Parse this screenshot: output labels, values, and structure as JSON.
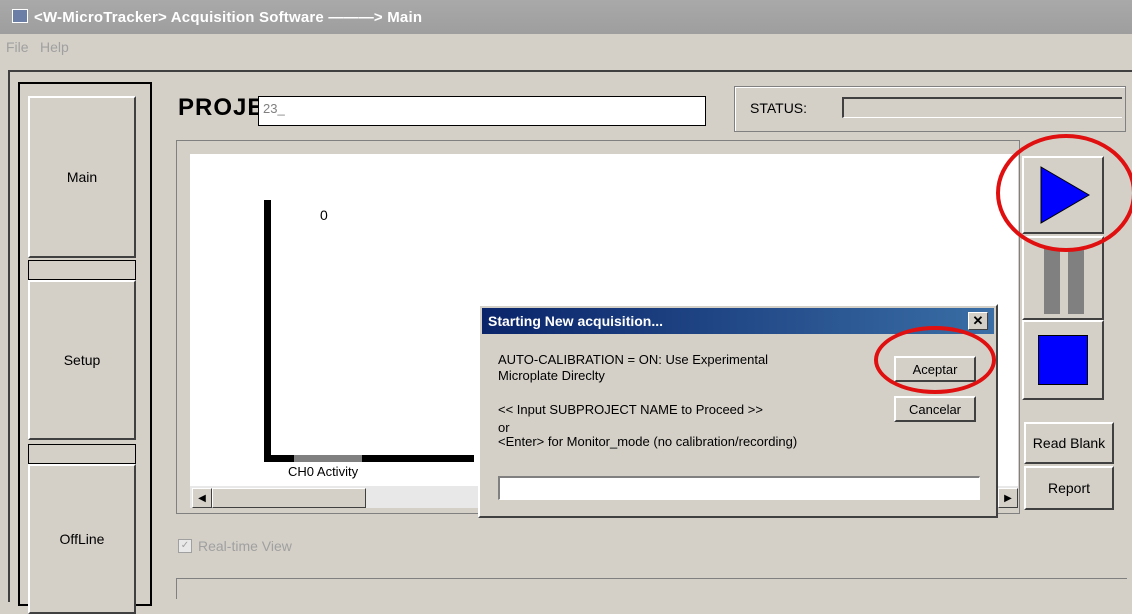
{
  "window": {
    "title": "<W-MicroTracker> Acquisition Software  ———> Main"
  },
  "menu": [
    "File",
    "Help"
  ],
  "nav": [
    {
      "label": "Main"
    },
    {
      "label": "Setup"
    },
    {
      "label": "OffLine"
    }
  ],
  "project": {
    "label": "PROJECT :",
    "value": "23_"
  },
  "status": {
    "label": "STATUS:"
  },
  "plot": {
    "y_value_label": "0",
    "channel_label": "CH0 Activity"
  },
  "realtime": {
    "label": "Real-time View",
    "checked": true
  },
  "right_buttons": {
    "read_blank": "Read Blank",
    "report": "Report"
  },
  "dialog": {
    "title": "Starting New acquisition...",
    "close_glyph": "✕",
    "line1": "AUTO-CALIBRATION = ON: Use Experimental",
    "line2": "Microplate Direclty",
    "line3": "<< Input SUBPROJECT NAME to Proceed >>",
    "line4": "or",
    "line5": "<Enter> for Monitor_mode (no calibration/recording)",
    "ok": "Aceptar",
    "cancel": "Cancelar",
    "input_value": ""
  },
  "colors": {
    "play": "#0000ff",
    "stop": "#0000ff",
    "highlight": "#e01010"
  }
}
